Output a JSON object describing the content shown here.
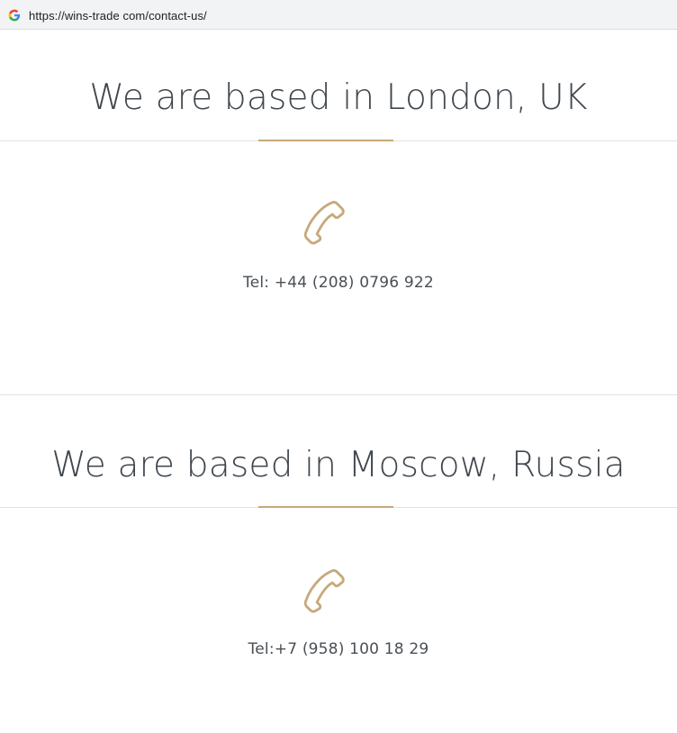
{
  "browser": {
    "url": "https://wins-trade com/contact-us/",
    "favicon": "google-g-icon"
  },
  "colors": {
    "accent": "#c7a97b",
    "heading": "#3f464d",
    "text": "#4a4f55",
    "divider": "#e2e2e2"
  },
  "sections": [
    {
      "heading": "We are based in London, UK",
      "icon": "phone-icon",
      "tel": "Tel: +44 (208) 0796 922"
    },
    {
      "heading": "We are based in Moscow, Russia",
      "icon": "phone-icon",
      "tel": "Tel:+7 (958) 100 18 29"
    }
  ]
}
